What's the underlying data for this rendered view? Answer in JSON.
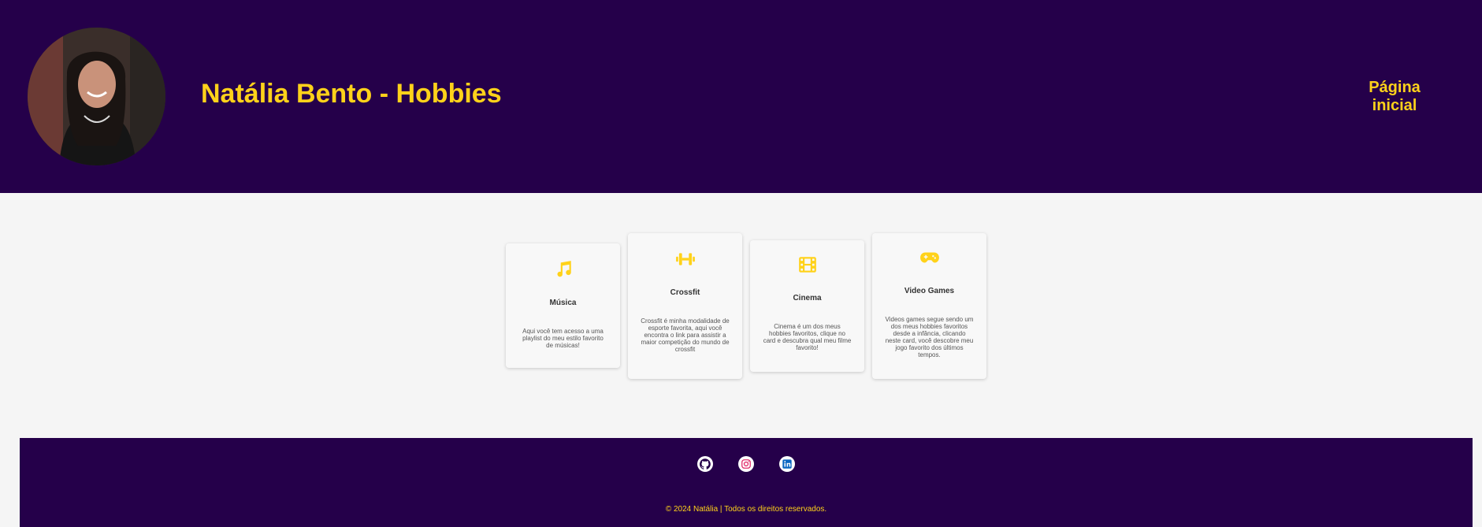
{
  "header": {
    "title": "Natália Bento - Hobbies",
    "nav_link": "Página inicial",
    "avatar_icon": "profile-photo"
  },
  "cards": [
    {
      "title": "Música",
      "text": "Aqui você tem acesso a uma playlist do meu estilo favorito de músicas!",
      "icon": "music-note-icon"
    },
    {
      "title": "Crossfit",
      "text": "Crossfit é minha modalidade de esporte favorita, aqui você encontra o link para assistir a maior competição do mundo de crossfit",
      "icon": "dumbbell-icon"
    },
    {
      "title": "Cinema",
      "text": "Cinema é um dos meus hobbies favoritos, clique no card e descubra qual meu filme favorito!",
      "icon": "film-icon"
    },
    {
      "title": "Video Games",
      "text": "Videos games segue sendo um dos meus hobbies favoritos desde a infância, clicando neste card, você descobre meu jogo favorito dos últimos tempos.",
      "icon": "gamepad-icon"
    }
  ],
  "footer": {
    "social": [
      "github-icon",
      "instagram-icon",
      "linkedin-icon"
    ],
    "copyright": "© 2024 Natália | Todos os direitos reservados."
  },
  "colors": {
    "header_bg": "#25004a",
    "accent": "#ffd21a",
    "page_bg": "#f5f5f5"
  }
}
